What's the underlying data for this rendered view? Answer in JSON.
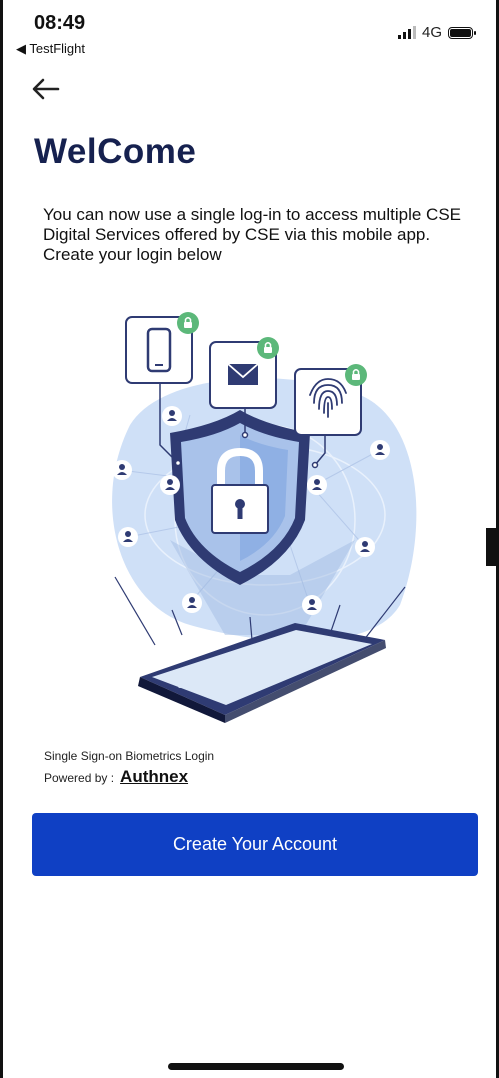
{
  "status": {
    "time": "08:49",
    "back_app": "◀ TestFlight",
    "network": "4G"
  },
  "page": {
    "title": "WelCome",
    "intro": "You can now use a single log-in to access multiple CSE Digital Services offered by CSE via this mobile app. Create your login below"
  },
  "footer": {
    "sso_text": "Single Sign-on Biometrics Login",
    "powered_by": "Powered by :",
    "brand": "Authnex"
  },
  "actions": {
    "create_account": "Create Your Account"
  },
  "colors": {
    "title": "#16214f",
    "primary_button": "#0f40c4",
    "lock_badge": "#5cb87a",
    "shield": "#2f3b73",
    "glow": "#cfe0f7"
  },
  "icons": [
    "back-arrow-icon",
    "signal-icon",
    "battery-icon",
    "phone-icon",
    "mail-icon",
    "fingerprint-icon",
    "padlock-icon",
    "user-icon"
  ]
}
